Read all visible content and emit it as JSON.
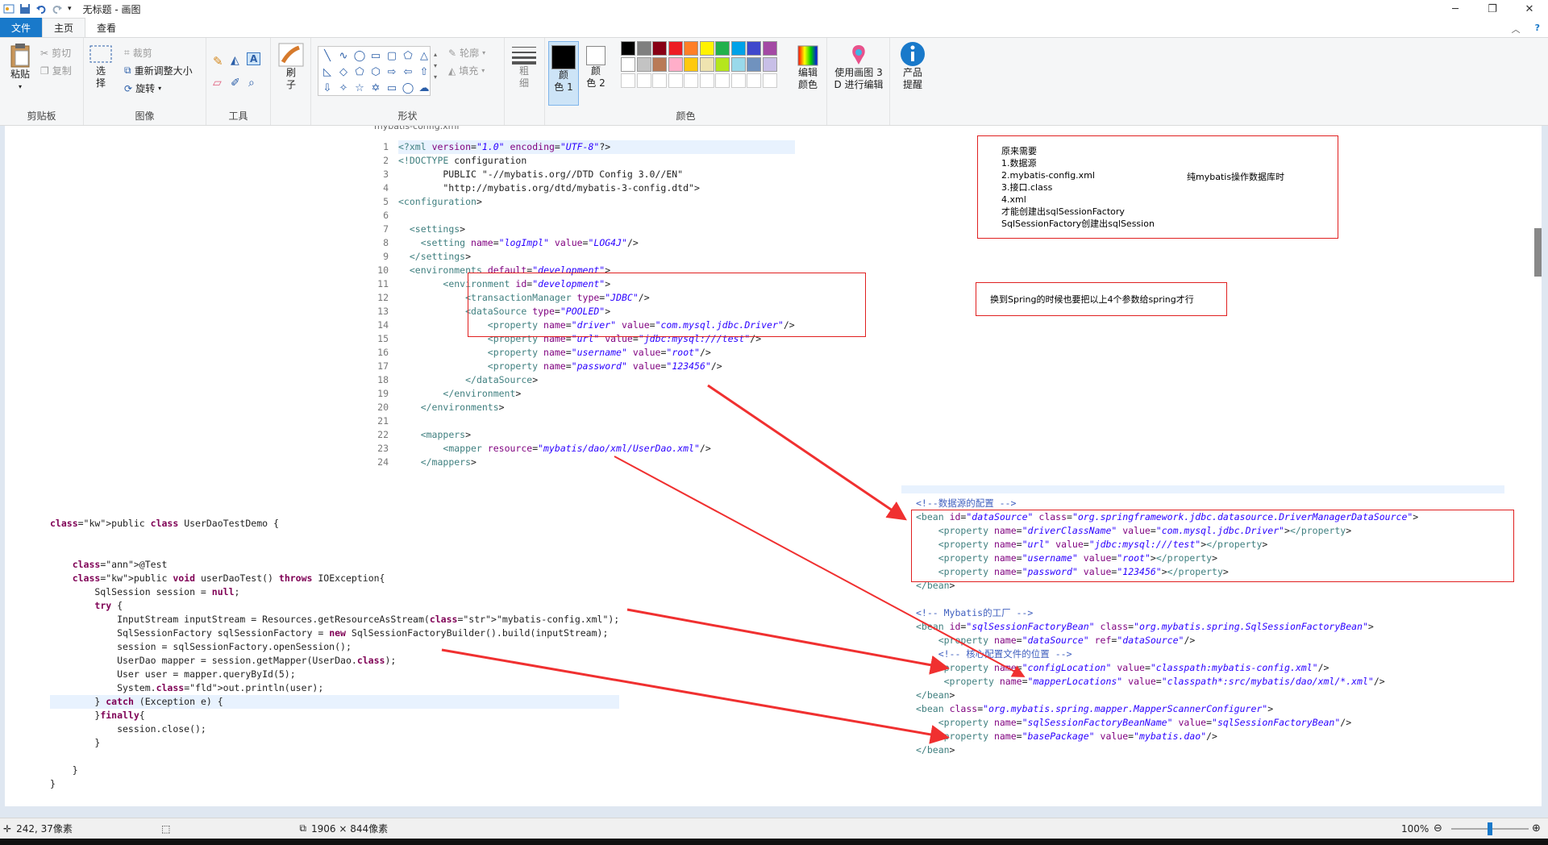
{
  "window": {
    "title": "无标题 - 画图",
    "controls": {
      "minimize": "─",
      "maximize": "❐",
      "close": "✕"
    }
  },
  "menu_tabs": [
    "文件",
    "主页",
    "查看"
  ],
  "ribbon": {
    "clipboard": {
      "paste": "粘贴",
      "cut": "剪切",
      "copy": "复制",
      "label": "剪贴板"
    },
    "image": {
      "select": "选\n择",
      "crop": "裁剪",
      "resize": "重新调整大小",
      "rotate": "旋转",
      "label": "图像"
    },
    "tools": {
      "label": "工具"
    },
    "brushes": {
      "label": "刷\n子"
    },
    "shapes": {
      "outline": "轮廓",
      "fill": "填充",
      "label": "形状"
    },
    "size": {
      "label": "粗\n细"
    },
    "colors": {
      "color1": "颜\n色 1",
      "color2": "颜\n色 2",
      "edit": "编辑\n颜色",
      "label": "颜色",
      "palette_row1": [
        "#000000",
        "#7f7f7f",
        "#880015",
        "#ed1c24",
        "#ff7f27",
        "#fff200",
        "#22b14c",
        "#00a2e8",
        "#3f48cc",
        "#a349a4"
      ],
      "palette_row2": [
        "#ffffff",
        "#c3c3c3",
        "#b97a57",
        "#ffaec9",
        "#ffc90e",
        "#efe4b0",
        "#b5e61d",
        "#99d9ea",
        "#7092be",
        "#c8bfe7"
      ]
    },
    "paint3d": "使用画图 3\nD 进行编辑",
    "product_alert": "产品\n提醒"
  },
  "xml_editor": {
    "tab_title": "mybatis-config.xml",
    "line_numbers": [
      "1",
      "2",
      "3",
      "4",
      "5",
      "6",
      "7",
      "8",
      "9",
      "10",
      "11",
      "12",
      "13",
      "14",
      "15",
      "16",
      "17",
      "18",
      "19",
      "20",
      "21",
      "22",
      "23",
      "24"
    ],
    "lines": [
      "<?xml version=\"1.0\" encoding=\"UTF-8\"?>",
      "<!DOCTYPE configuration",
      "        PUBLIC \"-//mybatis.org//DTD Config 3.0//EN\"",
      "        \"http://mybatis.org/dtd/mybatis-3-config.dtd\">",
      "<configuration>",
      "",
      "  <settings>",
      "    <setting name=\"logImpl\" value=\"LOG4J\"/>",
      "  </settings>",
      "  <environments default=\"development\">",
      "        <environment id=\"development\">",
      "            <transactionManager type=\"JDBC\"/>",
      "            <dataSource type=\"POOLED\">",
      "                <property name=\"driver\" value=\"com.mysql.jdbc.Driver\"/>",
      "                <property name=\"url\" value=\"jdbc:mysql:///test\"/>",
      "                <property name=\"username\" value=\"root\"/>",
      "                <property name=\"password\" value=\"123456\"/>",
      "            </dataSource>",
      "        </environment>",
      "    </environments>",
      "",
      "    <mappers>",
      "        <mapper resource=\"mybatis/dao/xml/UserDao.xml\"/>",
      "    </mappers>"
    ]
  },
  "java_code": [
    "public class UserDaoTestDemo {",
    "",
    "",
    "    @Test",
    "    public void userDaoTest() throws IOException{",
    "        SqlSession session = null;",
    "        try {",
    "            InputStream inputStream = Resources.getResourceAsStream(\"mybatis-config.xml\");",
    "            SqlSessionFactory sqlSessionFactory = new SqlSessionFactoryBuilder().build(inputStream);",
    "            session = sqlSessionFactory.openSession();",
    "            UserDao mapper = session.getMapper(UserDao.class);",
    "            User user = mapper.queryById(5);",
    "            System.out.println(user);",
    "        } catch (Exception e) {",
    "        }finally{",
    "            session.close();",
    "        }",
    "",
    "    }",
    "}"
  ],
  "spring_code": [
    "<!--数据源的配置 -->",
    "<bean id=\"dataSource\" class=\"org.springframework.jdbc.datasource.DriverManagerDataSource\">",
    "    <property name=\"driverClassName\" value=\"com.mysql.jdbc.Driver\"></property>",
    "    <property name=\"url\" value=\"jdbc:mysql:///test\"></property>",
    "    <property name=\"username\" value=\"root\"></property>",
    "    <property name=\"password\" value=\"123456\"></property>",
    "</bean>",
    "",
    "<!-- Mybatis的工厂 -->",
    "<bean id=\"sqlSessionFactoryBean\" class=\"org.mybatis.spring.SqlSessionFactoryBean\">",
    "    <property name=\"dataSource\" ref=\"dataSource\"/>",
    "    <!-- 核心配置文件的位置 -->",
    "    <property name=\"configLocation\" value=\"classpath:mybatis-config.xml\"/>",
    "     <property name=\"mapperLocations\" value=\"classpath*:src/mybatis/dao/xml/*.xml\"/>",
    "</bean>",
    "<bean class=\"org.mybatis.spring.mapper.MapperScannerConfigurer\">",
    "    <property name=\"sqlSessionFactoryBeanName\" value=\"sqlSessionFactoryBean\"/>",
    "    <property name=\"basePackage\" value=\"mybatis.dao\"/>",
    "</bean>"
  ],
  "notes": {
    "box1": [
      "原来需要",
      "1.数据源",
      "2.mybatis-config.xml",
      "3.接口.class",
      "4.xml",
      "才能创建出sqlSessionFactory",
      "SqlSessionFactory创建出sqlSession"
    ],
    "box1_side": "纯mybatis操作数据库时",
    "box2": "换到Spring的时候也要把以上4个参数给spring才行"
  },
  "statusbar": {
    "cursor_pos": "242, 37像素",
    "canvas_size": "1906 × 844像素",
    "zoom": "100%",
    "zoom_level": 0.5
  },
  "colors": {
    "accent": "#1979ca",
    "annotation_red": "#e02020",
    "arrow_red": "#f03030"
  }
}
